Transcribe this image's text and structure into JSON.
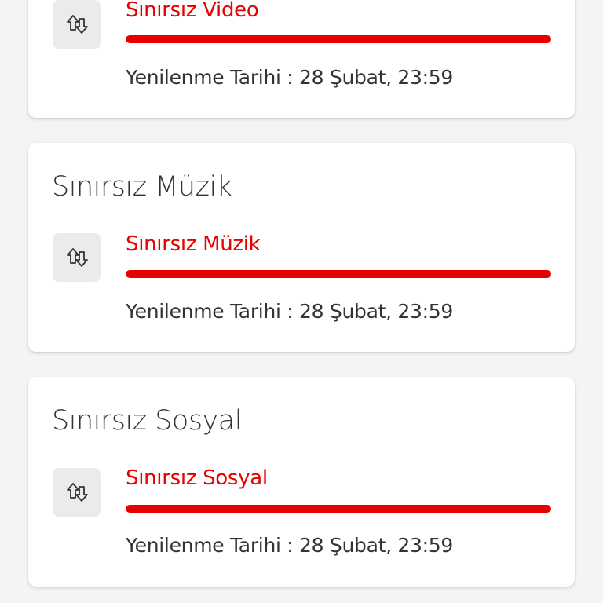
{
  "colors": {
    "accent": "#e60000",
    "text": "#333333",
    "icon_bg": "#ebebeb"
  },
  "cards": [
    {
      "title": "",
      "icon": "data-transfer-arrows-icon",
      "service_name": "Sınırsız Video",
      "usage_fill_fraction": 1.0,
      "renewal_text": "Yenilenme Tarihi : 28 Şubat, 23:59"
    },
    {
      "title": "Sınırsız Müzik",
      "icon": "data-transfer-arrows-icon",
      "service_name": "Sınırsız Müzik",
      "usage_fill_fraction": 1.0,
      "renewal_text": "Yenilenme Tarihi : 28 Şubat, 23:59"
    },
    {
      "title": "Sınırsız Sosyal",
      "icon": "data-transfer-arrows-icon",
      "service_name": "Sınırsız Sosyal",
      "usage_fill_fraction": 1.0,
      "renewal_text": "Yenilenme Tarihi : 28 Şubat, 23:59"
    }
  ]
}
